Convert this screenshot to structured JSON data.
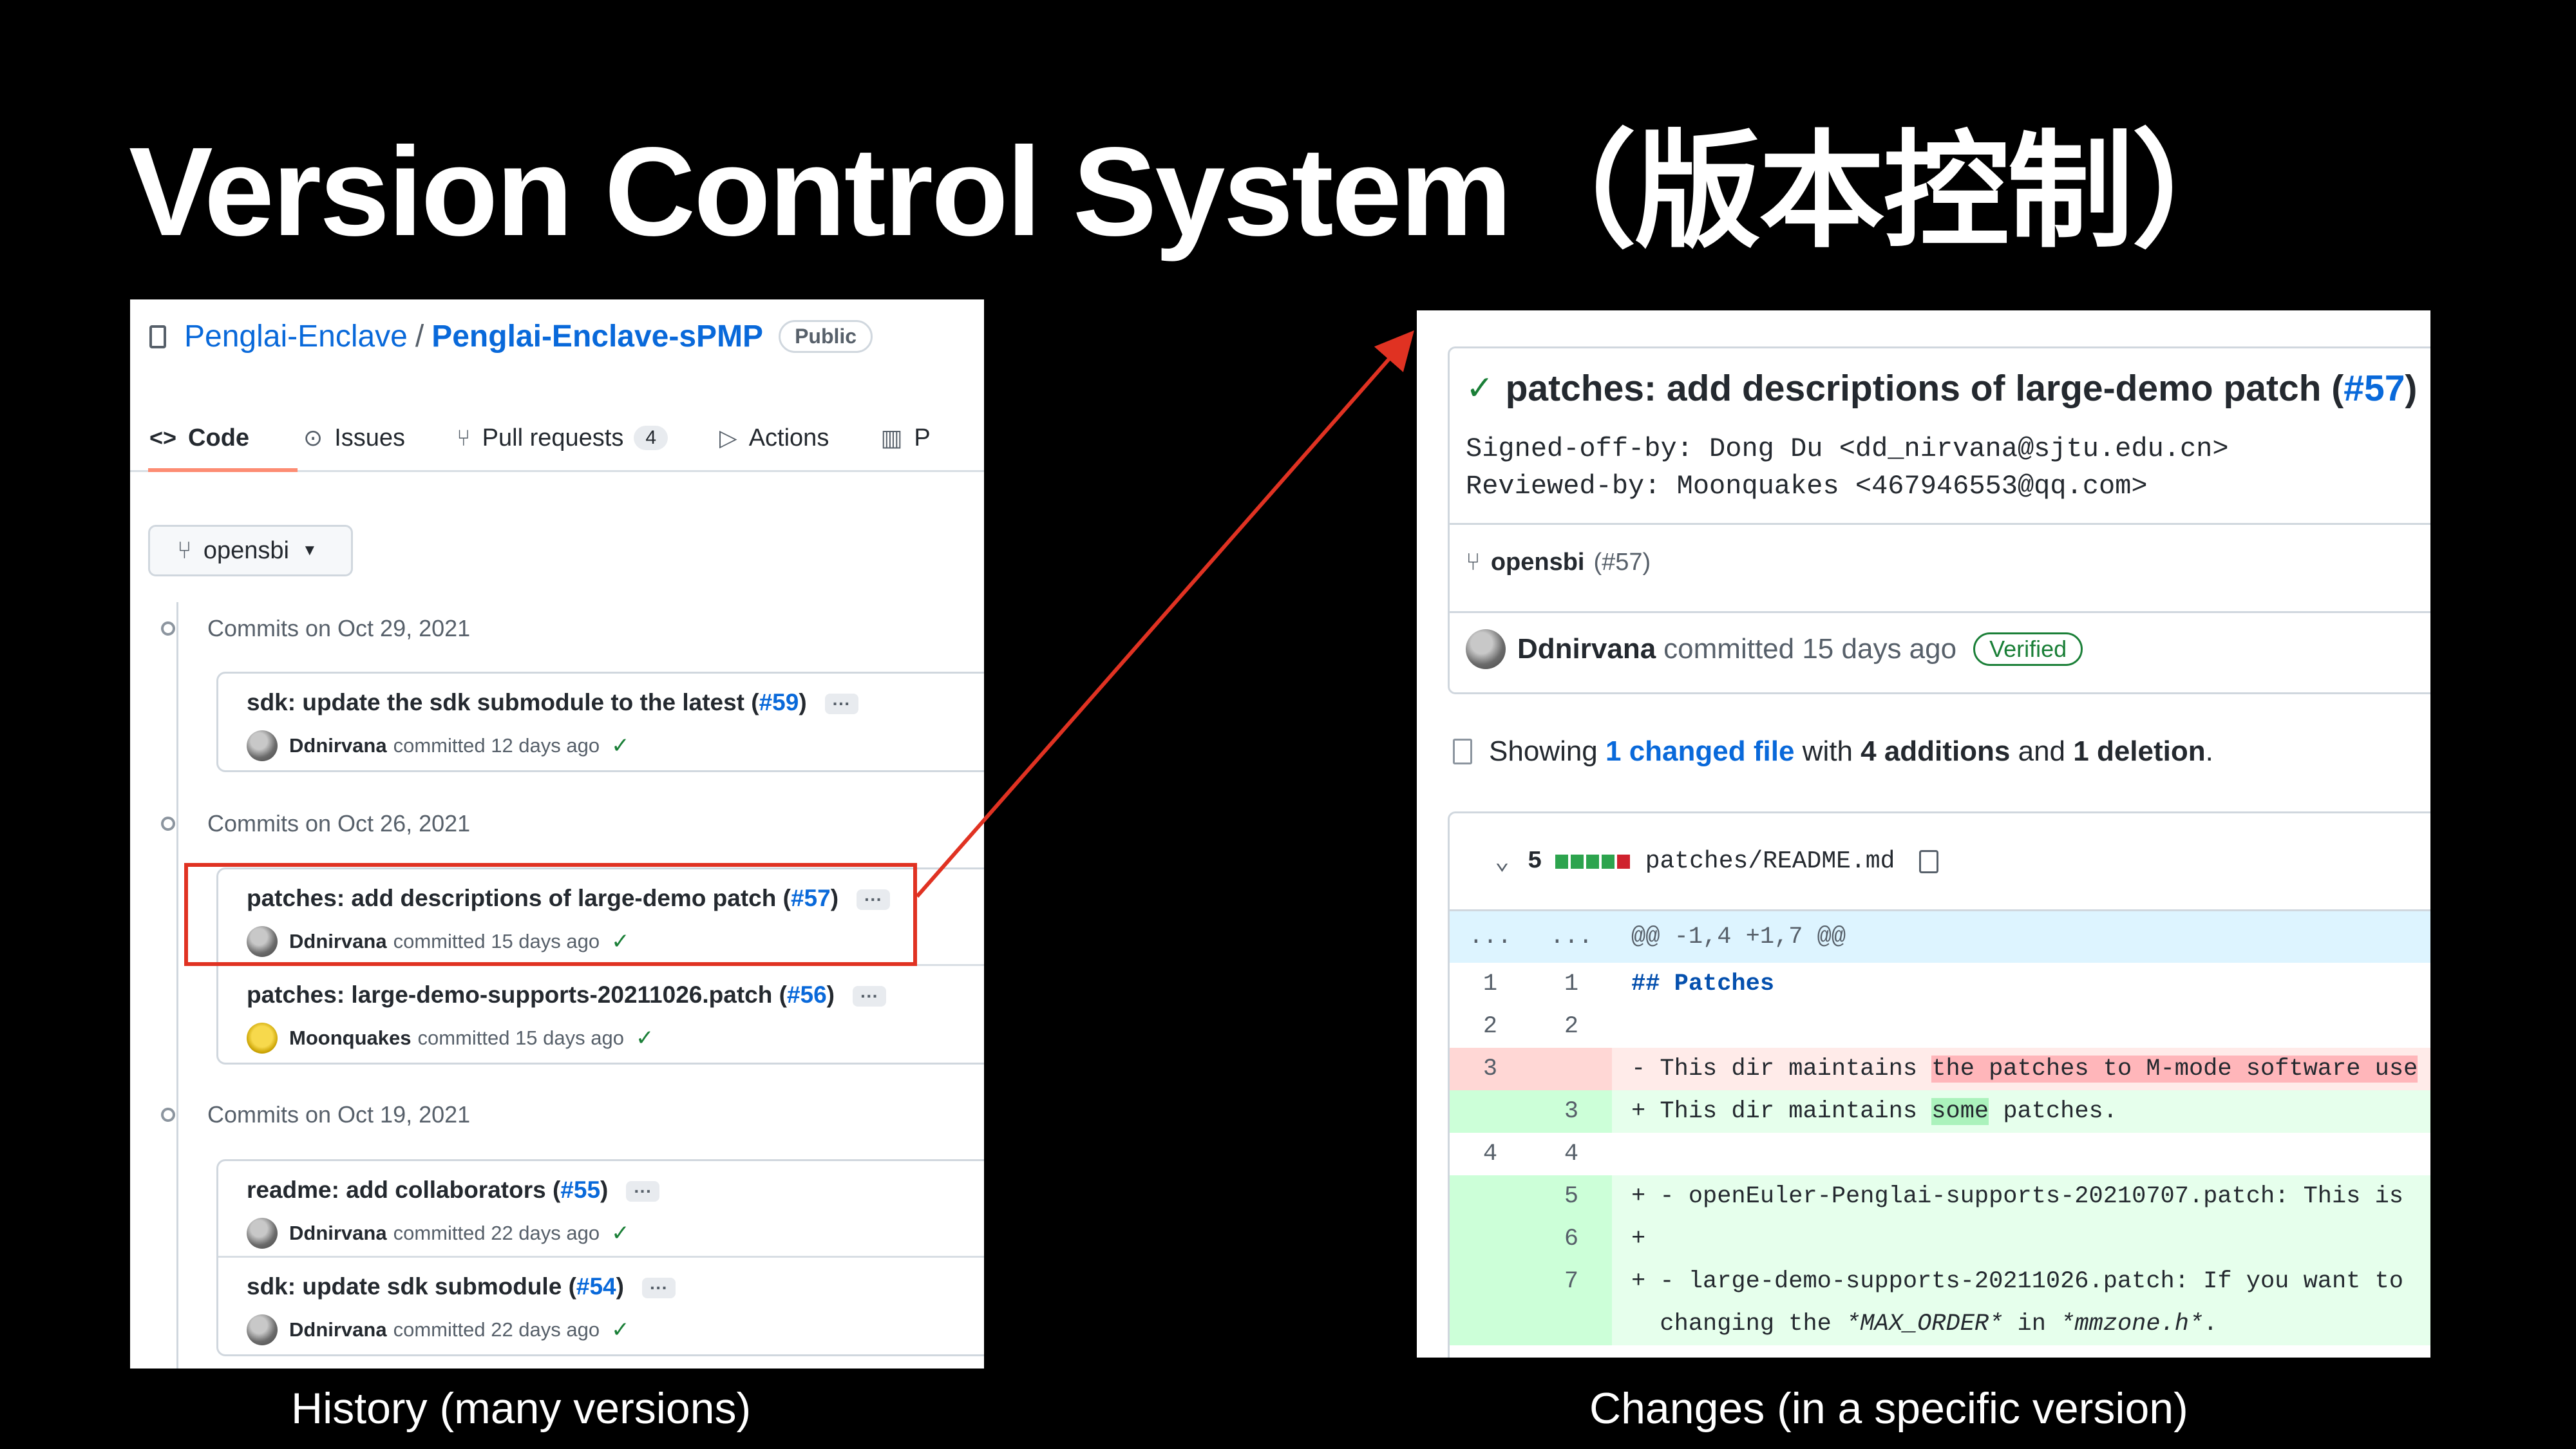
{
  "slide": {
    "title": "Version Control System（版本控制）",
    "caption_left": "History (many versions)",
    "caption_right": "Changes (in a specific version)",
    "accent_color": "#e03222"
  },
  "left": {
    "owner": "Penglai-Enclave",
    "separator": "/",
    "repo": "Penglai-Enclave-sPMP",
    "visibility": "Public",
    "tabs": [
      {
        "label": "Code",
        "icon": "code-icon"
      },
      {
        "label": "Issues",
        "icon": "issue-icon"
      },
      {
        "label": "Pull requests",
        "icon": "pull-request-icon",
        "count": "4"
      },
      {
        "label": "Actions",
        "icon": "play-icon"
      },
      {
        "label": "P",
        "icon": "project-icon"
      }
    ],
    "branch": "opensbi",
    "groups": [
      {
        "date": "Commits on Oct 29, 2021",
        "commits": [
          {
            "title": "sdk: update the sdk submodule to the latest (",
            "pr": "#59",
            "close": ")",
            "author": "Ddnirvana",
            "when": "committed 12 days ago"
          }
        ]
      },
      {
        "date": "Commits on Oct 26, 2021",
        "commits": [
          {
            "title": "patches: add descriptions of large-demo patch (",
            "pr": "#57",
            "close": ")",
            "author": "Ddnirvana",
            "when": "committed 15 days ago"
          },
          {
            "title": "patches: large-demo-supports-20211026.patch (",
            "pr": "#56",
            "close": ")",
            "author": "Moonquakes",
            "when": "committed 15 days ago"
          }
        ]
      },
      {
        "date": "Commits on Oct 19, 2021",
        "commits": [
          {
            "title": "readme: add collaborators (",
            "pr": "#55",
            "close": ")",
            "author": "Ddnirvana",
            "when": "committed 22 days ago"
          },
          {
            "title": "sdk: update sdk submodule (",
            "pr": "#54",
            "close": ")",
            "author": "Ddnirvana",
            "when": "committed 22 days ago"
          }
        ]
      }
    ],
    "more_label": "···"
  },
  "right": {
    "commit_title": "patches: add descriptions of large-demo patch (",
    "commit_pr": "#57",
    "commit_close": ")",
    "signed_off": "Signed-off-by: Dong Du <dd_nirvana@sjtu.edu.cn>",
    "reviewed": "Reviewed-by: Moonquakes <467946553@qq.com>",
    "branch": "opensbi",
    "branch_pr": "(#57)",
    "author": "Ddnirvana",
    "when": "committed 15 days ago",
    "verified": "Verified",
    "summary": {
      "showing": "Showing ",
      "changed": "1 changed file",
      "with": " with ",
      "additions": "4 additions",
      "and": " and ",
      "deletions": "1 deletion",
      "end": "."
    },
    "file": {
      "count": "5",
      "path": "patches/README.md"
    },
    "hunk": "@@ -1,4 +1,7 @@",
    "dots": "...",
    "lines": [
      {
        "old": "1",
        "new": "1",
        "text": "## Patches"
      },
      {
        "old": "2",
        "new": "2",
        "text": ""
      },
      {
        "old": "3",
        "new": "",
        "pre": "- This dir maintains ",
        "w1": "the",
        "mid": " patches",
        "w2": " to M-mode software use"
      },
      {
        "old": "",
        "new": "3",
        "pre": "+ This dir maintains ",
        "w1": "some",
        "post": " patches."
      },
      {
        "old": "4",
        "new": "4",
        "text": ""
      },
      {
        "old": "",
        "new": "5",
        "text": "+ - openEuler-Penglai-supports-20210707.patch: This is"
      },
      {
        "old": "",
        "new": "6",
        "text": "+"
      },
      {
        "old": "",
        "new": "7",
        "text": "+ - large-demo-supports-20211026.patch: If you want to"
      },
      {
        "old": "",
        "new": "",
        "pre": "  changing the ",
        "i1": "*MAX_ORDER*",
        "mid": " in ",
        "i2": "*mmzone.h*",
        "post": "."
      }
    ]
  }
}
